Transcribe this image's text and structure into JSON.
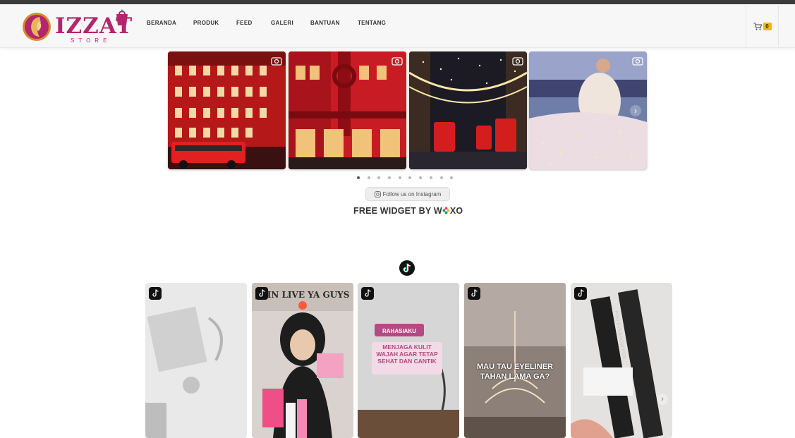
{
  "header": {
    "logo_text": "IZZAT",
    "logo_sub": "STORE",
    "nav": [
      "BERANDA",
      "PRODUK",
      "FEED",
      "GALERI",
      "BANTUAN",
      "TENTANG"
    ],
    "cart_count": "0"
  },
  "instagram": {
    "follow_label": "Follow us on Instagram",
    "credit_prefix": "FREE WIDGET BY W",
    "credit_suffix": "XO",
    "slide_count": 10,
    "active_slide": 1,
    "images": [
      {
        "description": "red-building-advent"
      },
      {
        "description": "red-bow-storefront"
      },
      {
        "description": "street-lights-buses"
      },
      {
        "description": "woman-bed-fairy-lights"
      }
    ]
  },
  "tiktok": {
    "cards": [
      {
        "overlay": ""
      },
      {
        "overlay": "JOIN LIVE YA GUYS"
      },
      {
        "tag": "RAHASIAKU",
        "overlay": "MENJAGA KULIT WAJAH AGAR TETAP SEHAT DAN CANTIK"
      },
      {
        "overlay": "MAU TAU EYELINER TAHAN LAMA GA?"
      },
      {
        "overlay": "PRO EYEBROW PEN"
      }
    ]
  },
  "colors": {
    "brand": "#b2266d",
    "badge": "#f2b705",
    "header_bg": "#f7f7f7"
  }
}
